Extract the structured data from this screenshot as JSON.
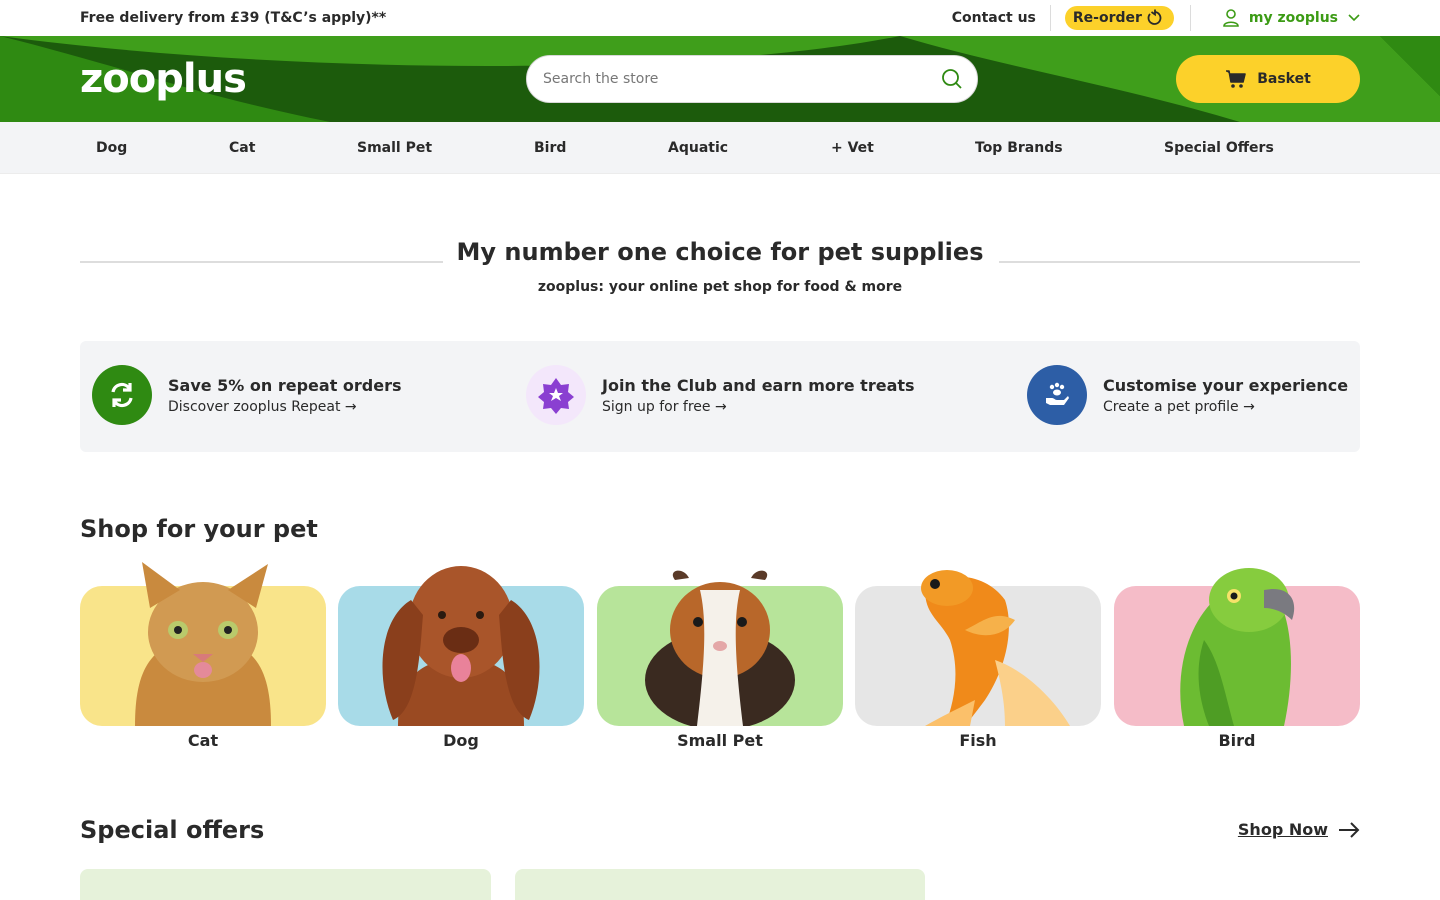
{
  "topbar": {
    "delivery_text": "Free delivery from £39 (T&C’s apply)**",
    "contact_label": "Contact us",
    "reorder_label": "Re-order",
    "account_label": "my zooplus"
  },
  "header": {
    "logo_text": "zooplus",
    "search_placeholder": "Search the store",
    "basket_label": "Basket"
  },
  "nav": {
    "items": [
      {
        "label": "Dog"
      },
      {
        "label": "Cat"
      },
      {
        "label": "Small Pet"
      },
      {
        "label": "Bird"
      },
      {
        "label": "Aquatic"
      },
      {
        "label": "+ Vet"
      },
      {
        "label": "Top Brands"
      },
      {
        "label": "Special Offers"
      }
    ]
  },
  "hero": {
    "title": "My number one choice for pet supplies",
    "subtitle": "zooplus: your online pet shop for food & more"
  },
  "benefits": [
    {
      "title": "Save 5% on repeat orders",
      "link": "Discover zooplus Repeat",
      "icon": "repeat-icon"
    },
    {
      "title": "Join the Club and earn more treats",
      "link": "Sign up for free",
      "icon": "star-badge-icon"
    },
    {
      "title": "Customise your experience",
      "link": "Create a pet profile",
      "icon": "paw-hand-icon"
    }
  ],
  "shop_for_pet": {
    "title": "Shop for your pet",
    "pets": [
      {
        "label": "Cat",
        "bg": "#f9e48a"
      },
      {
        "label": "Dog",
        "bg": "#a8dbe8"
      },
      {
        "label": "Small Pet",
        "bg": "#b7e49a"
      },
      {
        "label": "Fish",
        "bg": "#e6e6e6"
      },
      {
        "label": "Bird",
        "bg": "#f5bcc8"
      }
    ]
  },
  "special_offers": {
    "title": "Special offers",
    "shop_now": "Shop Now"
  },
  "colors": {
    "brand_green": "#1c5b0c",
    "accent_yellow": "#fcd12a",
    "link_green": "#3c9b15"
  }
}
